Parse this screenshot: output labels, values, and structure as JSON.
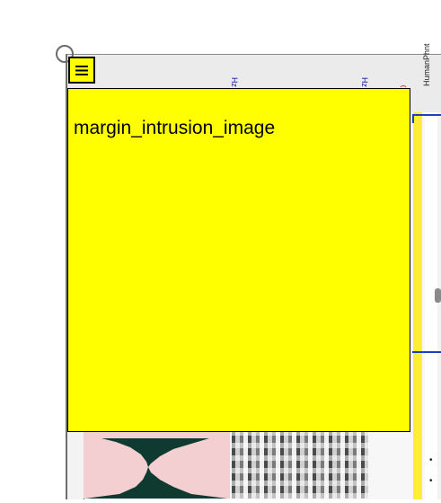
{
  "overlay": {
    "label": "margin_intrusion_image"
  },
  "background_labels": {
    "hz_left": "Hz",
    "hz_right": "Hz",
    "side_title": "HumanPhnt"
  },
  "colors": {
    "overlay": "#ffff00",
    "accent_blue": "#1f3fb8"
  },
  "icons": {
    "menu": "hamburger-menu-icon",
    "handle": "circle-handle-icon"
  }
}
